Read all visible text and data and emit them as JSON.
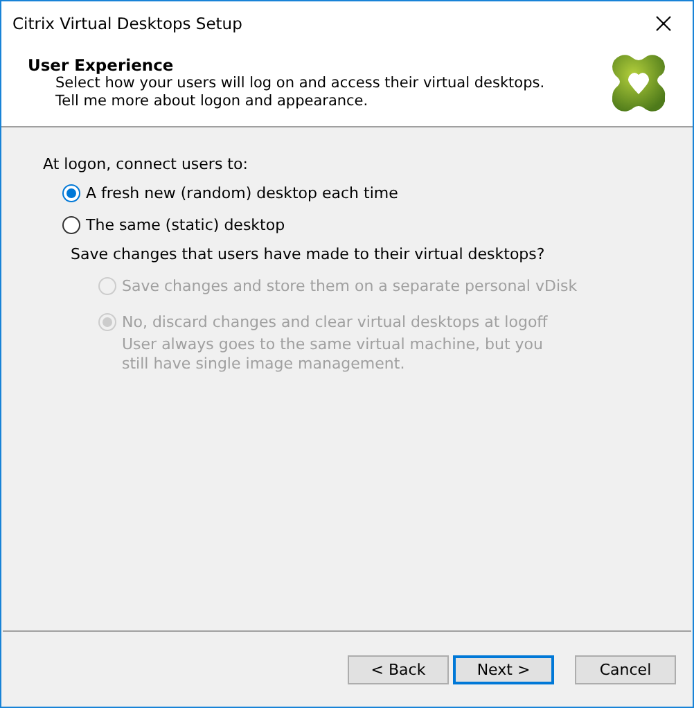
{
  "window": {
    "title": "Citrix Virtual Desktops Setup"
  },
  "header": {
    "title": "User Experience",
    "lines": [
      "Select how your users will log on and access their virtual desktops.",
      "Tell me more about logon and appearance."
    ]
  },
  "prompt": "At logon, connect users to:",
  "options": [
    {
      "label": "A fresh new (random) desktop each time",
      "selected": true,
      "disabled": false
    },
    {
      "label": "The same (static) desktop",
      "selected": false,
      "disabled": false
    }
  ],
  "sub_prompt": "Save changes that users have made to their virtual desktops?",
  "sub_options": [
    {
      "label": "Save changes and store them on a separate personal vDisk",
      "selected": false,
      "disabled": true
    },
    {
      "label": "No, discard changes and clear virtual desktops at logoff",
      "selected": true,
      "disabled": true,
      "description": "User always goes to the same virtual machine, but you still have single image management."
    }
  ],
  "buttons": [
    {
      "label": "< Back",
      "default": false
    },
    {
      "label": "Next >",
      "default": true
    },
    {
      "label": "Cancel",
      "default": false
    }
  ]
}
